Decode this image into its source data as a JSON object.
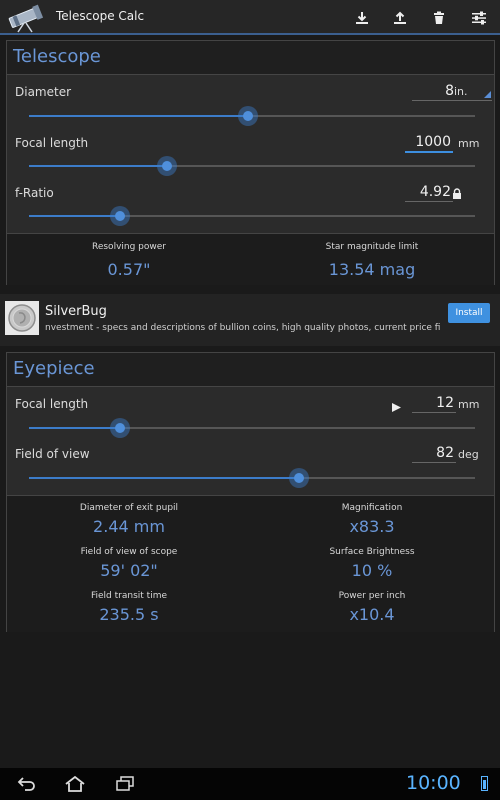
{
  "app": {
    "title": "Telescope Calc"
  },
  "colors": {
    "accent": "#6a96d6",
    "slider": "#3c7cc9",
    "install": "#3f91e0",
    "clock": "#5ab4ff"
  },
  "actions": [
    {
      "icon": "download-icon"
    },
    {
      "icon": "upload-icon"
    },
    {
      "icon": "trash-icon"
    },
    {
      "icon": "sliders-icon"
    }
  ],
  "telescope": {
    "title": "Telescope",
    "diameter": {
      "label": "Diameter",
      "value": "8",
      "unit": "in.",
      "slider_fraction": 0.49
    },
    "focal_length": {
      "label": "Focal length",
      "value": "1000",
      "unit": "mm",
      "slider_fraction": 0.31
    },
    "f_ratio": {
      "label": "f-Ratio",
      "value": "4.92",
      "unit_icon": "lock-icon",
      "slider_fraction": 0.205
    },
    "results": [
      {
        "label": "Resolving power",
        "value": "0.57\""
      },
      {
        "label": "Star magnitude limit",
        "value": "13.54 mag"
      }
    ]
  },
  "ad": {
    "title": "SilverBug",
    "text": "nvestment - specs and descriptions of bullion coins, high quality photos, current price fixi",
    "install_label": "Install"
  },
  "eyepiece": {
    "title": "Eyepiece",
    "focal_length": {
      "label": "Focal length",
      "value": "12",
      "unit": "mm",
      "slider_fraction": 0.205
    },
    "field_of_view": {
      "label": "Field of view",
      "value": "82",
      "unit": "deg",
      "slider_fraction": 0.605
    },
    "results": [
      {
        "label": "Diameter of exit pupil",
        "value": "2.44 mm"
      },
      {
        "label": "Magnification",
        "value": "x83.3"
      },
      {
        "label": "Field of view of scope",
        "value": "59' 02\""
      },
      {
        "label": "Surface Brightness",
        "value": "10 %"
      },
      {
        "label": "Field transit time",
        "value": "235.5 s"
      },
      {
        "label": "Power per inch",
        "value": "x10.4"
      }
    ]
  },
  "status": {
    "clock": "10:00"
  }
}
